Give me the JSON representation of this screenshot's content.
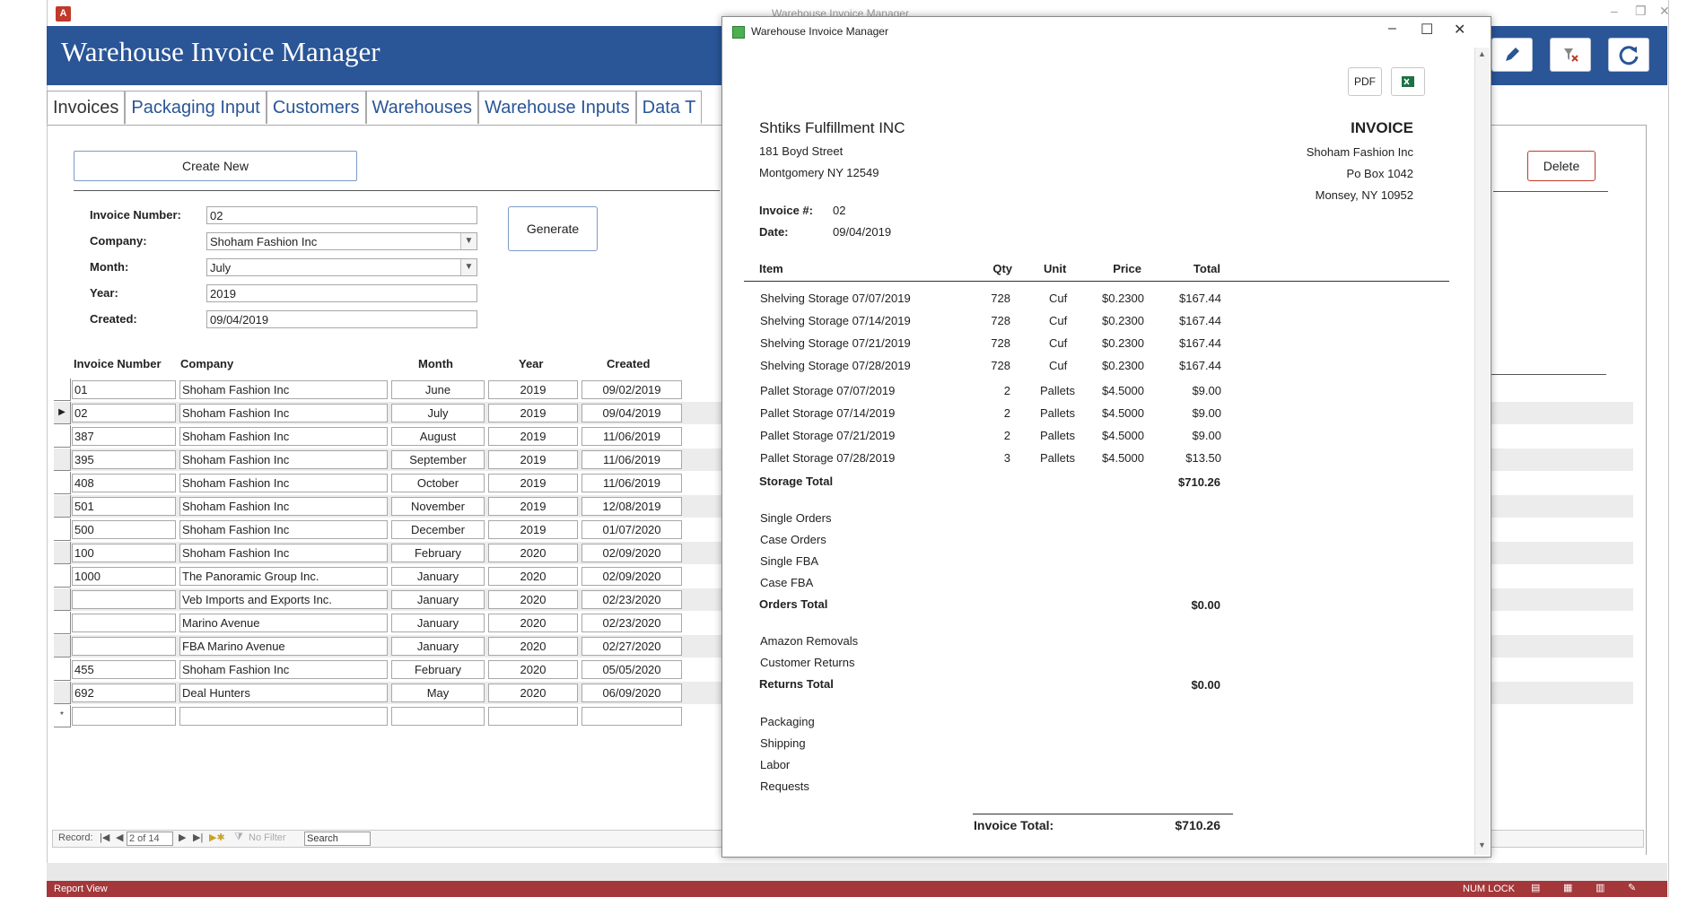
{
  "app": {
    "icon_label": "A",
    "title": "Warehouse Invoice Manager",
    "bg_title": "Warehouse Invoice Manager"
  },
  "tabs": [
    {
      "label": "Invoices"
    },
    {
      "label": "Packaging Input"
    },
    {
      "label": "Customers"
    },
    {
      "label": "Warehouses"
    },
    {
      "label": "Warehouse Inputs"
    },
    {
      "label": "Data T"
    }
  ],
  "form": {
    "create_new": "Create New",
    "generate": "Generate",
    "delete": "Delete",
    "invoice_number_label": "Invoice Number:",
    "invoice_number": "02",
    "company_label": "Company:",
    "company": "Shoham Fashion Inc",
    "month_label": "Month:",
    "month": "July",
    "year_label": "Year:",
    "year": "2019",
    "created_label": "Created:",
    "created": "09/04/2019"
  },
  "list": {
    "headers": {
      "invoice_number": "Invoice Number",
      "company": "Company",
      "month": "Month",
      "year": "Year",
      "created": "Created"
    },
    "rows": [
      {
        "inv": "01",
        "company": "Shoham Fashion Inc",
        "month": "June",
        "year": "2019",
        "created": "09/02/2019"
      },
      {
        "inv": "02",
        "company": "Shoham Fashion Inc",
        "month": "July",
        "year": "2019",
        "created": "09/04/2019"
      },
      {
        "inv": "387",
        "company": "Shoham Fashion Inc",
        "month": "August",
        "year": "2019",
        "created": "11/06/2019"
      },
      {
        "inv": "395",
        "company": "Shoham Fashion Inc",
        "month": "September",
        "year": "2019",
        "created": "11/06/2019"
      },
      {
        "inv": "408",
        "company": "Shoham Fashion Inc",
        "month": "October",
        "year": "2019",
        "created": "11/06/2019"
      },
      {
        "inv": "501",
        "company": "Shoham Fashion Inc",
        "month": "November",
        "year": "2019",
        "created": "12/08/2019"
      },
      {
        "inv": "500",
        "company": "Shoham Fashion Inc",
        "month": "December",
        "year": "2019",
        "created": "01/07/2020"
      },
      {
        "inv": "100",
        "company": "Shoham Fashion Inc",
        "month": "February",
        "year": "2020",
        "created": "02/09/2020"
      },
      {
        "inv": "1000",
        "company": "The Panoramic Group Inc.",
        "month": "January",
        "year": "2020",
        "created": "02/09/2020"
      },
      {
        "inv": "",
        "company": "Veb Imports and Exports Inc.",
        "month": "January",
        "year": "2020",
        "created": "02/23/2020"
      },
      {
        "inv": "",
        "company": "Marino Avenue",
        "month": "January",
        "year": "2020",
        "created": "02/23/2020"
      },
      {
        "inv": "",
        "company": "FBA Marino Avenue",
        "month": "January",
        "year": "2020",
        "created": "02/27/2020"
      },
      {
        "inv": "455",
        "company": "Shoham Fashion Inc",
        "month": "February",
        "year": "2020",
        "created": "05/05/2020"
      },
      {
        "inv": "692",
        "company": "Deal Hunters",
        "month": "May",
        "year": "2020",
        "created": "06/09/2020"
      }
    ],
    "new_row_marker": "*"
  },
  "nav": {
    "record_label": "Record:",
    "position": "2 of 14",
    "no_filter": "No Filter",
    "search": "Search"
  },
  "status": {
    "view": "Report View",
    "num_lock": "NUM LOCK"
  },
  "report_window": {
    "title": "Warehouse Invoice Manager",
    "pdf_label": "PDF",
    "from_name": "Shtiks Fulfillment INC",
    "from_street": "181 Boyd Street",
    "from_city": "Montgomery NY 12549",
    "invoice_heading": "INVOICE",
    "to_name": "Shoham Fashion Inc",
    "to_street": "Po Box 1042",
    "to_city": "Monsey, NY 10952",
    "invoice_no_label": "Invoice #:",
    "invoice_no": "02",
    "date_label": "Date:",
    "date": "09/04/2019",
    "columns": {
      "item": "Item",
      "qty": "Qty",
      "unit": "Unit",
      "price": "Price",
      "total": "Total"
    },
    "storage_lines": [
      {
        "item": "Shelving Storage 07/07/2019",
        "qty": "728",
        "unit": "Cuf",
        "price": "$0.2300",
        "total": "$167.44"
      },
      {
        "item": "Shelving Storage 07/14/2019",
        "qty": "728",
        "unit": "Cuf",
        "price": "$0.2300",
        "total": "$167.44"
      },
      {
        "item": "Shelving Storage 07/21/2019",
        "qty": "728",
        "unit": "Cuf",
        "price": "$0.2300",
        "total": "$167.44"
      },
      {
        "item": "Shelving Storage 07/28/2019",
        "qty": "728",
        "unit": "Cuf",
        "price": "$0.2300",
        "total": "$167.44"
      },
      {
        "item": "Pallet Storage 07/07/2019",
        "qty": "2",
        "unit": "Pallets",
        "price": "$4.5000",
        "total": "$9.00"
      },
      {
        "item": "Pallet Storage 07/14/2019",
        "qty": "2",
        "unit": "Pallets",
        "price": "$4.5000",
        "total": "$9.00"
      },
      {
        "item": "Pallet Storage 07/21/2019",
        "qty": "2",
        "unit": "Pallets",
        "price": "$4.5000",
        "total": "$9.00"
      },
      {
        "item": "Pallet Storage 07/28/2019",
        "qty": "3",
        "unit": "Pallets",
        "price": "$4.5000",
        "total": "$13.50"
      }
    ],
    "storage_total_label": "Storage Total",
    "storage_total": "$710.26",
    "orders_items": [
      "Single Orders",
      "Case Orders",
      "Single FBA",
      "Case FBA"
    ],
    "orders_total_label": "Orders Total",
    "orders_total": "$0.00",
    "returns_items": [
      "Amazon Removals",
      "Customer Returns"
    ],
    "returns_total_label": "Returns Total",
    "returns_total": "$0.00",
    "other_items": [
      "Packaging",
      "Shipping",
      "Labor",
      "Requests"
    ],
    "invoice_total_label": "Invoice Total:",
    "invoice_total": "$710.26"
  },
  "colors": {
    "header_blue": "#2a5597",
    "status_red": "#a4373a",
    "delete_red": "#c0392b"
  }
}
